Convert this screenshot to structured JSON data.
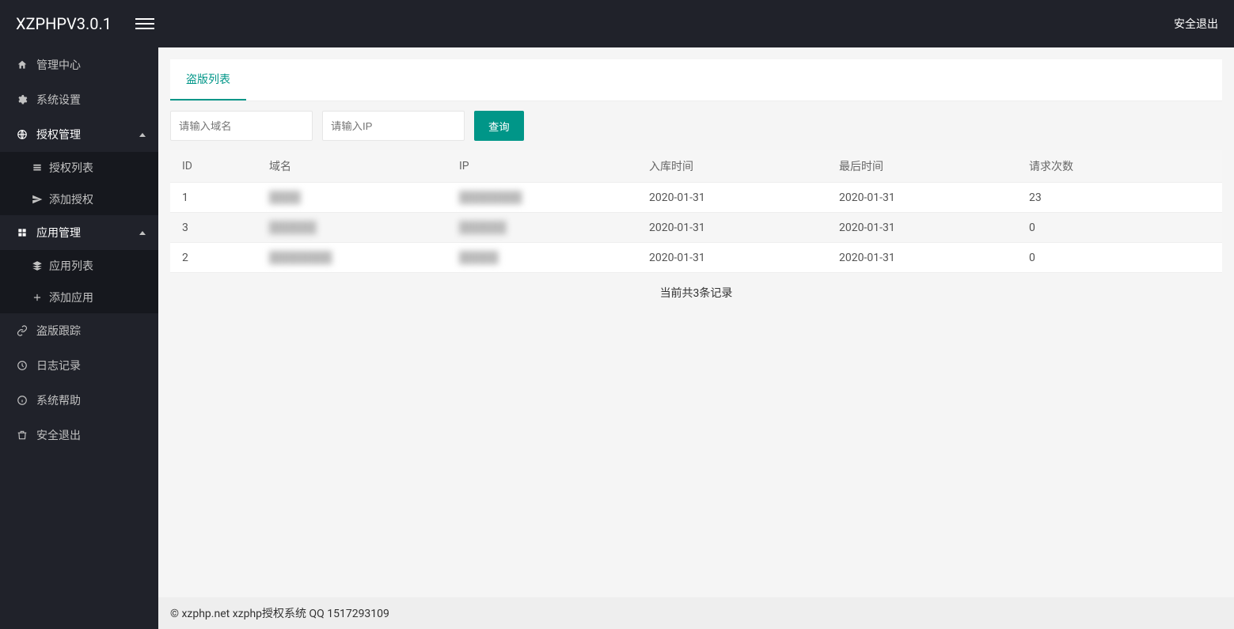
{
  "header": {
    "logo": "XZPHPV3.0.1",
    "logout": "安全退出"
  },
  "sidebar": {
    "admin_center": "管理中心",
    "system_settings": "系统设置",
    "auth_management": "授权管理",
    "auth_list": "授权列表",
    "add_auth": "添加授权",
    "app_management": "应用管理",
    "app_list": "应用列表",
    "add_app": "添加应用",
    "piracy_tracking": "盗版跟踪",
    "log_record": "日志记录",
    "system_help": "系统帮助",
    "safe_exit": "安全退出"
  },
  "main": {
    "tab_label": "盗版列表",
    "domain_placeholder": "请输入域名",
    "ip_placeholder": "请输入IP",
    "query_button": "查询",
    "columns": {
      "id": "ID",
      "domain": "域名",
      "ip": "IP",
      "entry_time": "入库时间",
      "last_time": "最后时间",
      "request_count": "请求次数"
    },
    "rows": [
      {
        "id": "1",
        "domain": "████",
        "ip": "████████",
        "entry_time": "2020-01-31",
        "last_time": "2020-01-31",
        "request_count": "23"
      },
      {
        "id": "3",
        "domain": "██████",
        "ip": "██████",
        "entry_time": "2020-01-31",
        "last_time": "2020-01-31",
        "request_count": "0"
      },
      {
        "id": "2",
        "domain": "████████",
        "ip": "█████",
        "entry_time": "2020-01-31",
        "last_time": "2020-01-31",
        "request_count": "0"
      }
    ],
    "record_count": "当前共3条记录"
  },
  "footer": {
    "text": "© xzphp.net xzphp授权系统 QQ 1517293109"
  }
}
